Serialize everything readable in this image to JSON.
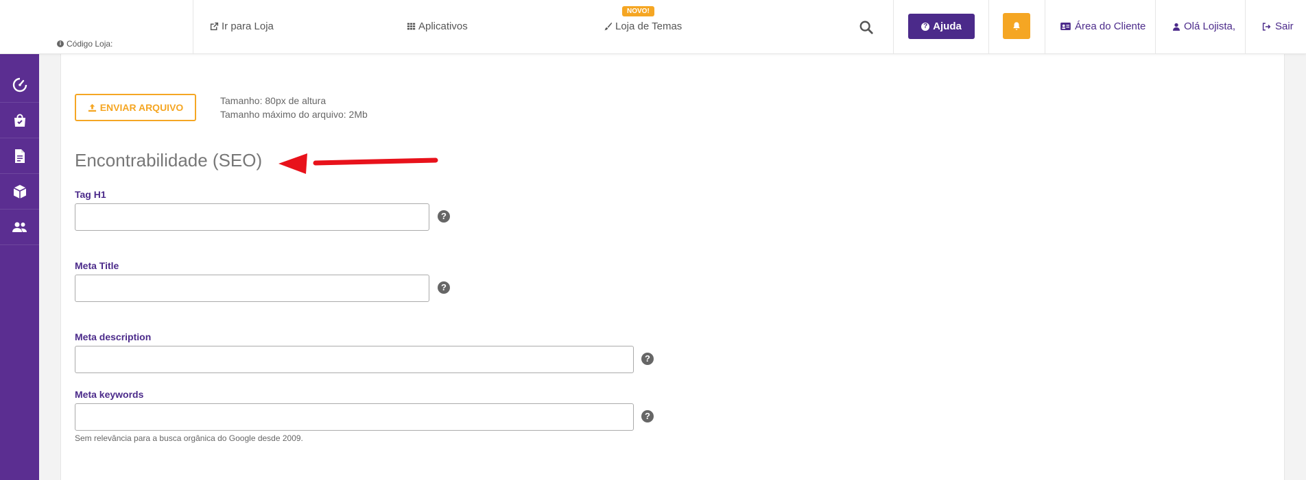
{
  "header": {
    "store_code_label": "Código Loja:",
    "nav": {
      "go_to_store": "Ir para Loja",
      "apps": "Aplicativos",
      "theme_store": "Loja de Temas",
      "new_badge": "NOVO!"
    },
    "help_label": "Ajuda",
    "client_area": "Área do Cliente",
    "greeting": "Olá Lojista,",
    "logout": "Sair"
  },
  "sidebar": {
    "items": [
      {
        "icon": "speedometer-icon"
      },
      {
        "icon": "shopping-bag-icon"
      },
      {
        "icon": "document-icon"
      },
      {
        "icon": "box-icon"
      },
      {
        "icon": "users-icon"
      }
    ]
  },
  "upload": {
    "button_label": "ENVIAR ARQUIVO",
    "info_line1": "Tamanho: 80px de altura",
    "info_line2": "Tamanho máximo do arquivo: 2Mb"
  },
  "seo": {
    "title": "Encontrabilidade (SEO)",
    "fields": {
      "tag_h1": {
        "label": "Tag H1",
        "value": ""
      },
      "meta_title": {
        "label": "Meta Title",
        "value": ""
      },
      "meta_description": {
        "label": "Meta description",
        "value": ""
      },
      "meta_keywords": {
        "label": "Meta keywords",
        "value": ""
      }
    },
    "keywords_note": "Sem relevância para a busca orgânica do Google desde 2009."
  },
  "colors": {
    "brand_purple": "#5b2e91",
    "accent_orange": "#f5a623",
    "annotation_red": "#e8121b"
  }
}
